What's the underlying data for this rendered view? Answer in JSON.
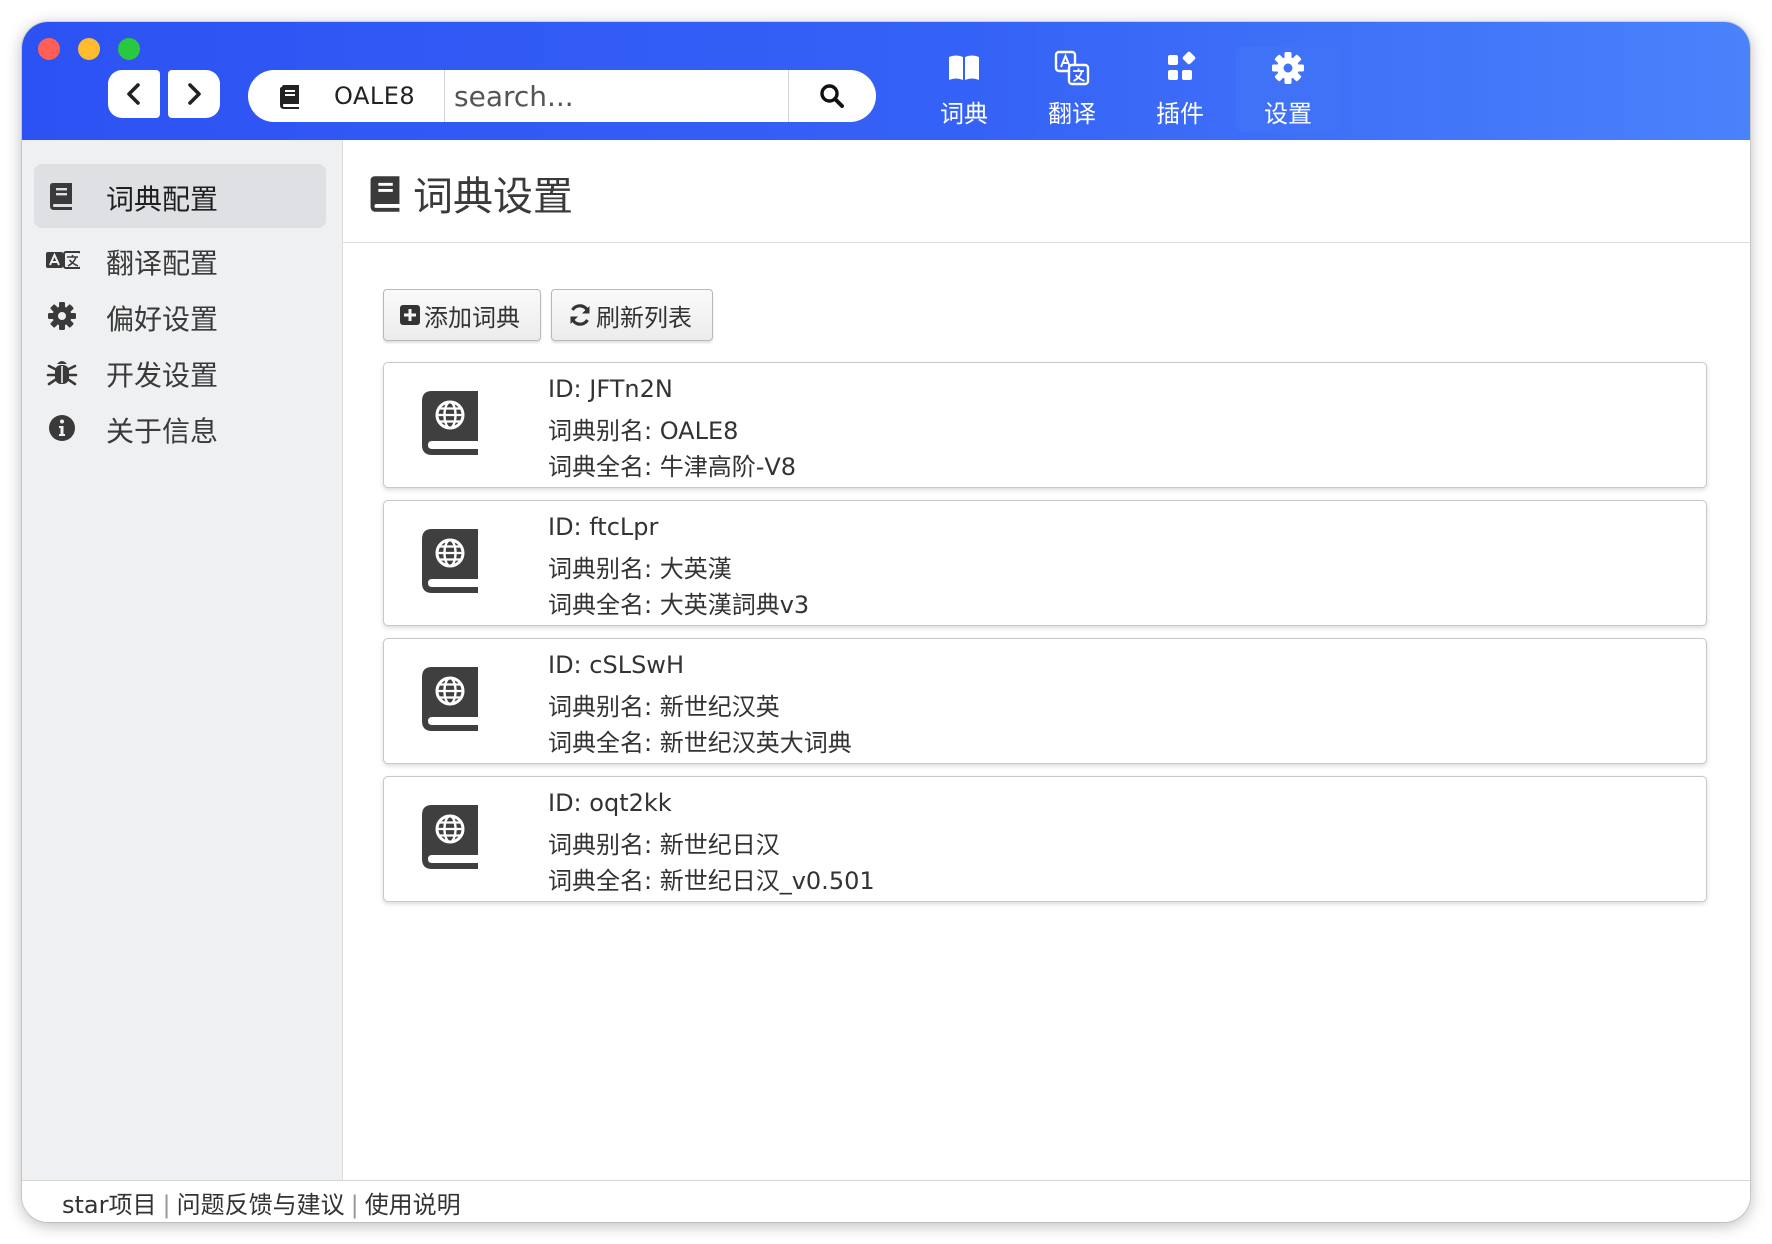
{
  "window": {
    "traffic_lights": [
      "close",
      "minimize",
      "zoom"
    ]
  },
  "toolbar": {
    "back_icon": "chevron-left-icon",
    "forward_icon": "chevron-right-icon",
    "search": {
      "dict_name": "OALE8",
      "placeholder": "search...",
      "value": ""
    },
    "tabs": [
      {
        "label": "词典",
        "icon": "book-open-icon",
        "active": false
      },
      {
        "label": "翻译",
        "icon": "translate-icon",
        "active": false
      },
      {
        "label": "插件",
        "icon": "puzzle-icon",
        "active": false
      },
      {
        "label": "设置",
        "icon": "gear-icon",
        "active": true
      }
    ]
  },
  "sidebar": {
    "items": [
      {
        "label": "词典配置",
        "icon": "book-icon",
        "active": true
      },
      {
        "label": "翻译配置",
        "icon": "language-icon",
        "active": false
      },
      {
        "label": "偏好设置",
        "icon": "gear-icon",
        "active": false
      },
      {
        "label": "开发设置",
        "icon": "bug-icon",
        "active": false
      },
      {
        "label": "关于信息",
        "icon": "info-icon",
        "active": false
      }
    ]
  },
  "main": {
    "title": "词典设置",
    "buttons": {
      "add": "添加词典",
      "refresh": "刷新列表"
    },
    "dictionaries": [
      {
        "id_line": "ID: JFTn2N",
        "alias_line": "词典别名: OALE8",
        "fullname_line": "词典全名: 牛津高阶-V8"
      },
      {
        "id_line": "ID: ftcLpr",
        "alias_line": "词典别名: 大英漢",
        "fullname_line": "词典全名: 大英漢詞典v3"
      },
      {
        "id_line": "ID: cSLSwH",
        "alias_line": "词典别名: 新世纪汉英",
        "fullname_line": "词典全名: 新世纪汉英大词典"
      },
      {
        "id_line": "ID: oqt2kk",
        "alias_line": "词典别名: 新世纪日汉",
        "fullname_line": "词典全名: 新世纪日汉_v0.501"
      }
    ]
  },
  "footer": {
    "links": [
      "star项目",
      "问题反馈与建议",
      "使用说明"
    ],
    "separator": "|"
  },
  "colors": {
    "topbar_start": "#2d52f4",
    "topbar_end": "#4a82fb",
    "active_tab": "#3f72f7",
    "sidebar_bg": "#eff0f2",
    "icon_dark": "#3a3a3a"
  }
}
